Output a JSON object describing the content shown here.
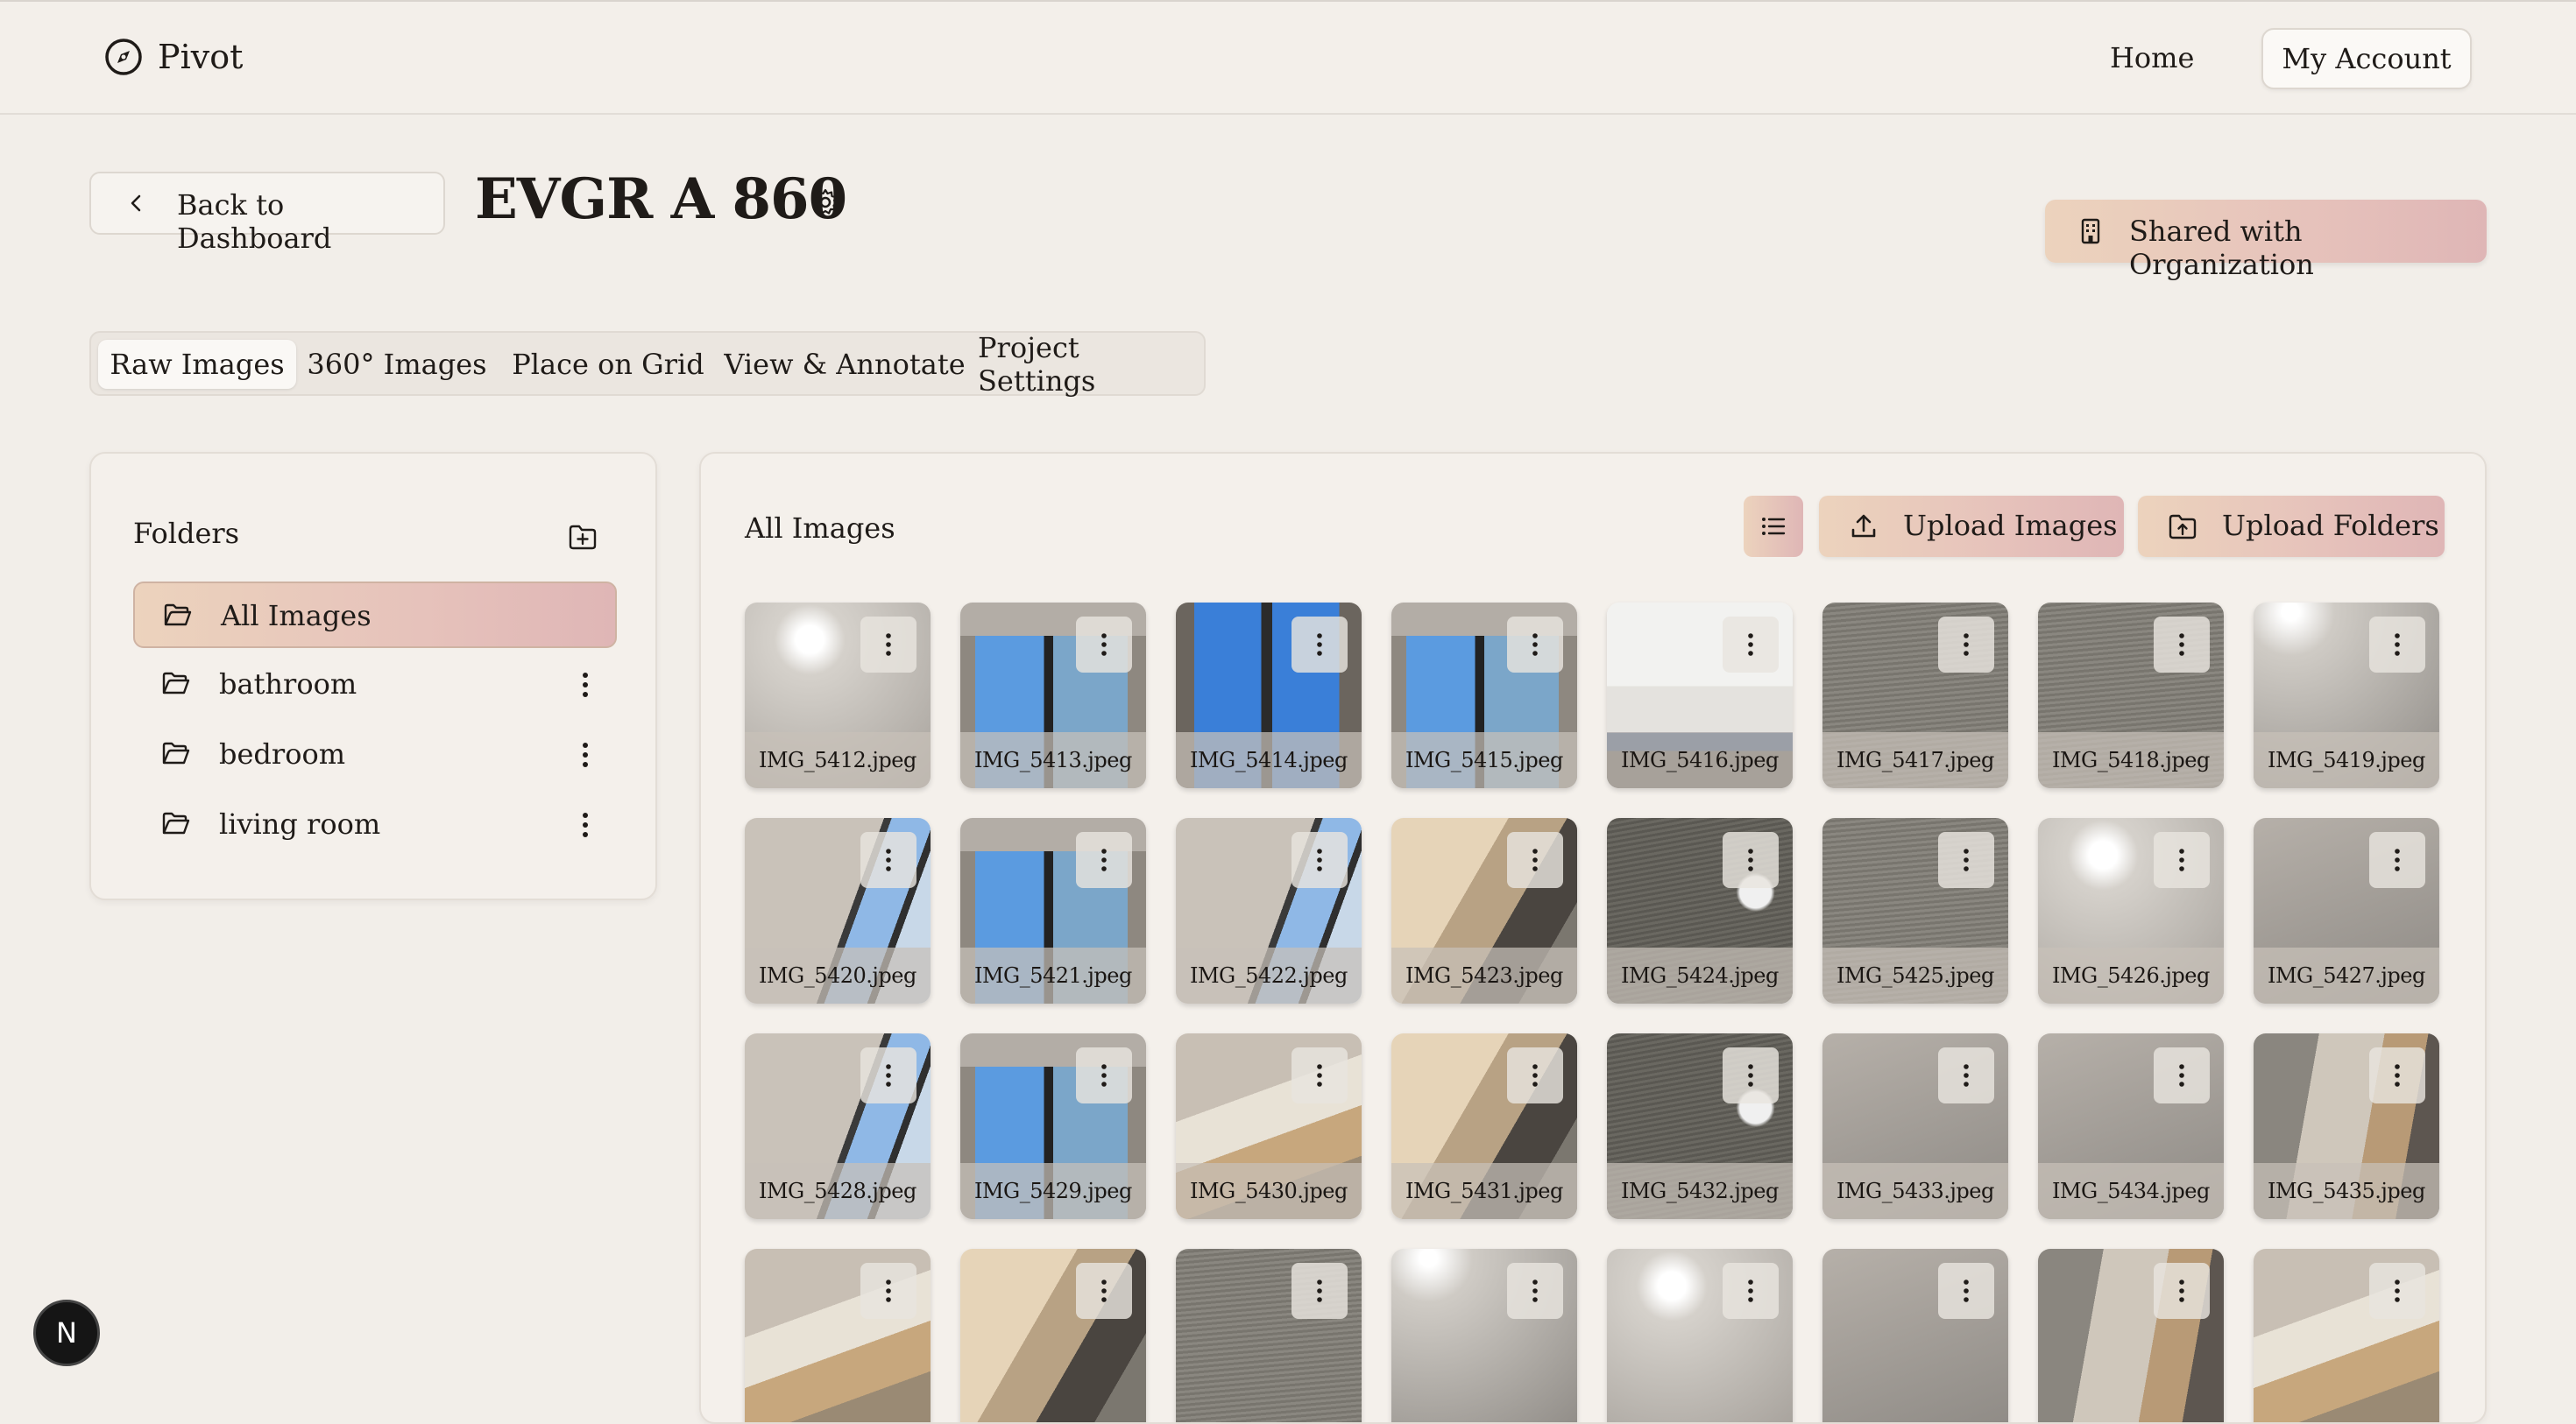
{
  "app": {
    "name": "Pivot"
  },
  "nav": {
    "home": "Home",
    "account": "My Account"
  },
  "header": {
    "back_label": "Back to Dashboard",
    "project_title": "EVGR A 860",
    "shared_label": "Shared with Organization"
  },
  "tabs": [
    {
      "label": "Raw Images",
      "active": true
    },
    {
      "label": "360° Images",
      "active": false
    },
    {
      "label": "Place on Grid",
      "active": false
    },
    {
      "label": "View & Annotate",
      "active": false
    },
    {
      "label": "Project Settings",
      "active": false
    }
  ],
  "folders": {
    "title": "Folders",
    "items": [
      {
        "label": "All Images",
        "active": true
      },
      {
        "label": "bathroom",
        "active": false
      },
      {
        "label": "bedroom",
        "active": false
      },
      {
        "label": "living room",
        "active": false
      }
    ]
  },
  "images": {
    "title": "All Images",
    "upload_images": "Upload Images",
    "upload_folders": "Upload Folders",
    "items": [
      {
        "name": "IMG_5412.jpeg",
        "style": "p-ceiling"
      },
      {
        "name": "IMG_5413.jpeg",
        "style": "p-window2"
      },
      {
        "name": "IMG_5414.jpeg",
        "style": "p-window"
      },
      {
        "name": "IMG_5415.jpeg",
        "style": "p-window2"
      },
      {
        "name": "IMG_5416.jpeg",
        "style": "p-counter"
      },
      {
        "name": "IMG_5417.jpeg",
        "style": "p-carpet"
      },
      {
        "name": "IMG_5418.jpeg",
        "style": "p-carpet"
      },
      {
        "name": "IMG_5419.jpeg",
        "style": "p-ceiling2"
      },
      {
        "name": "IMG_5420.jpeg",
        "style": "p-wall-window"
      },
      {
        "name": "IMG_5421.jpeg",
        "style": "p-window2"
      },
      {
        "name": "IMG_5422.jpeg",
        "style": "p-wall-window"
      },
      {
        "name": "IMG_5423.jpeg",
        "style": "p-wood"
      },
      {
        "name": "IMG_5424.jpeg",
        "style": "p-carpet2"
      },
      {
        "name": "IMG_5425.jpeg",
        "style": "p-carpet"
      },
      {
        "name": "IMG_5426.jpeg",
        "style": "p-ceiling"
      },
      {
        "name": "IMG_5427.jpeg",
        "style": "p-wall"
      },
      {
        "name": "IMG_5428.jpeg",
        "style": "p-wall-window"
      },
      {
        "name": "IMG_5429.jpeg",
        "style": "p-window2"
      },
      {
        "name": "IMG_5430.jpeg",
        "style": "p-bed"
      },
      {
        "name": "IMG_5431.jpeg",
        "style": "p-wood"
      },
      {
        "name": "IMG_5432.jpeg",
        "style": "p-carpet2"
      },
      {
        "name": "IMG_5433.jpeg",
        "style": "p-wall"
      },
      {
        "name": "IMG_5434.jpeg",
        "style": "p-wall"
      },
      {
        "name": "IMG_5435.jpeg",
        "style": "p-room"
      },
      {
        "name": "",
        "style": "p-bed"
      },
      {
        "name": "",
        "style": "p-wood"
      },
      {
        "name": "",
        "style": "p-carpet"
      },
      {
        "name": "",
        "style": "p-ceiling2"
      },
      {
        "name": "",
        "style": "p-ceiling"
      },
      {
        "name": "",
        "style": "p-wall"
      },
      {
        "name": "",
        "style": "p-room"
      },
      {
        "name": "",
        "style": "p-bed"
      }
    ]
  },
  "badge": {
    "letter": "N"
  },
  "colors": {
    "accent_start": "#ecd3bd",
    "accent_end": "#dfb6b6",
    "background": "#f2eee9"
  }
}
